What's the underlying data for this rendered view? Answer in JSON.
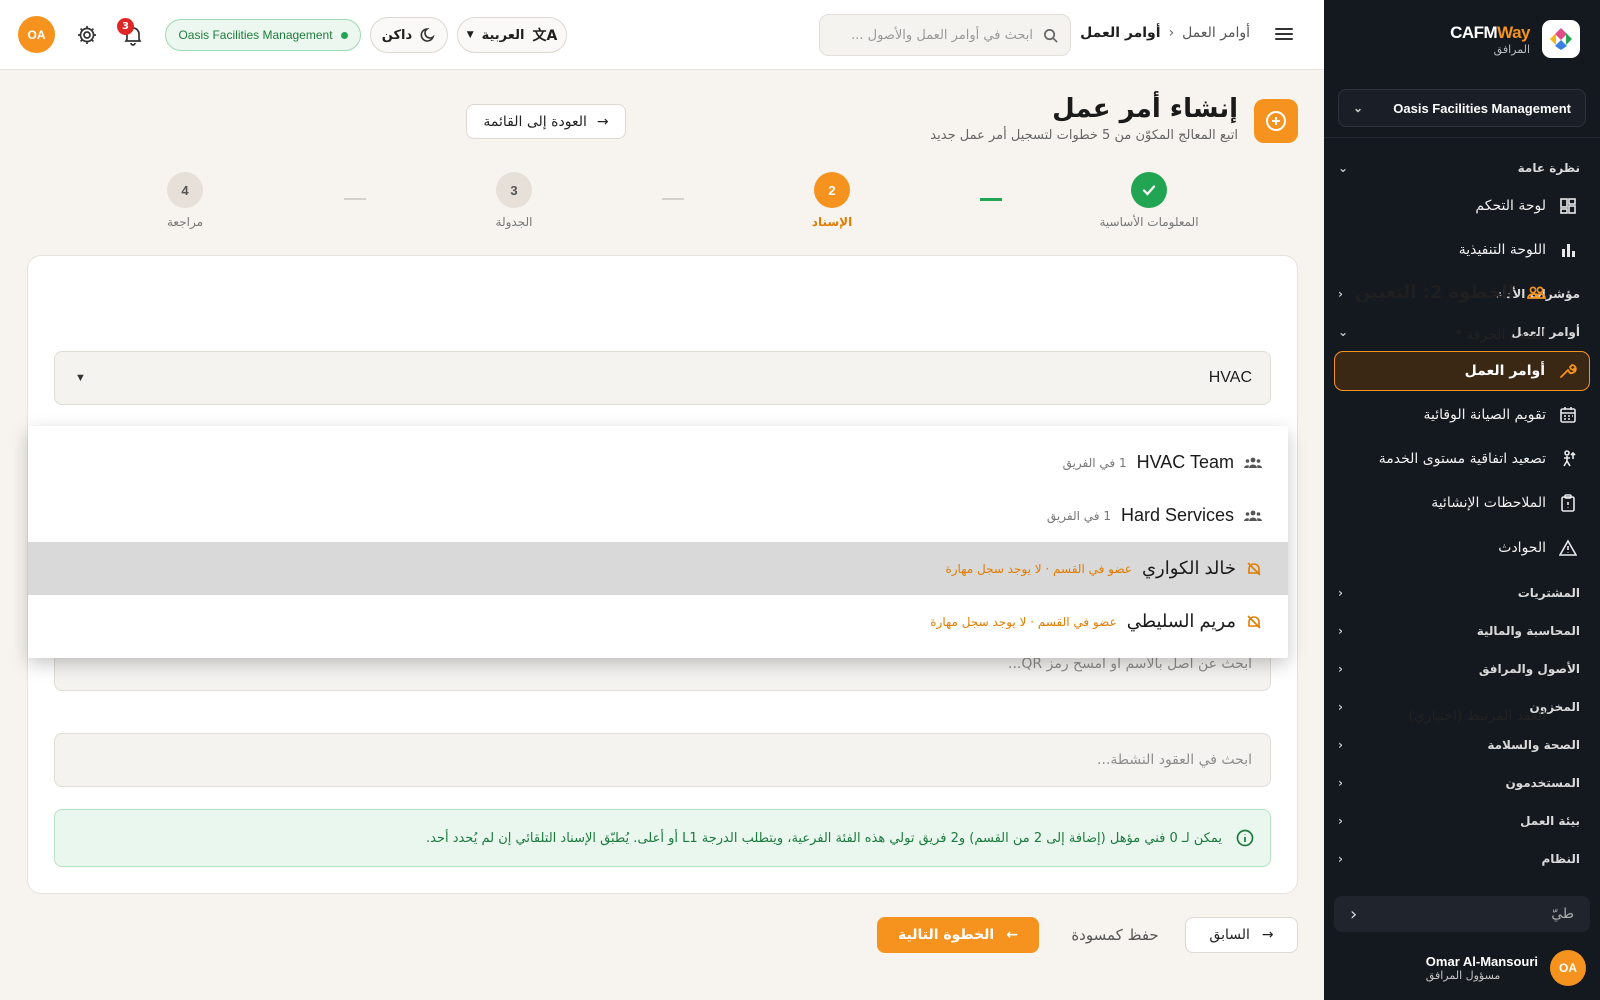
{
  "sidebar": {
    "brand_title_main": "CAFM",
    "brand_title_accent": "Way",
    "brand_subtitle": "المرافق",
    "org_selector": "Oasis Facilities Management",
    "sections": {
      "overview": "نظرة عامة",
      "kpi": "مؤشرات الأداء",
      "work_orders": "أوامر العمل",
      "procurement": "المشتريات",
      "accounting": "المحاسبة والمالية",
      "assets": "الأصول والمرافق",
      "inventory": "المخزون",
      "hse": "الصحة والسلامة",
      "users": "المستخدمون",
      "environment": "بيئة العمل",
      "system": "النظام"
    },
    "items": {
      "dashboard": "لوحة التحكم",
      "executive": "اللوحة التنفيذية",
      "work_orders": "أوامر العمل",
      "pm_calendar": "تقويم الصيانة الوقائية",
      "sla_escalation": "تصعيد اتفاقية مستوى الخدمة",
      "structural_notes": "الملاحظات الإنشائية",
      "incidents": "الحوادث"
    },
    "collapse_label": "طيّ",
    "user_initials": "OA",
    "user_name": "Omar Al-Mansouri",
    "user_role": "مسؤول المرافق"
  },
  "header": {
    "breadcrumb_parent": "أوامر العمل",
    "breadcrumb_current": "أوامر العمل",
    "search_placeholder": "ابحث في أوامر العمل والأصول ...",
    "language": "العربية",
    "theme": "داكن",
    "org": "Oasis Facilities Management",
    "notifications_count": "3",
    "avatar_initials": "OA"
  },
  "page": {
    "title": "إنشاء أمر عمل",
    "subtitle": "اتبع المعالج المكوّن من 5 خطوات لتسجيل أمر عمل جديد",
    "back_label": "العودة إلى القائمة"
  },
  "stepper": [
    {
      "label": "المعلومات الأساسية",
      "num": "1",
      "state": "done"
    },
    {
      "label": "الإسناد",
      "num": "2",
      "state": "current"
    },
    {
      "label": "الجدولة",
      "num": "3",
      "state": "todo"
    },
    {
      "label": "مراجعة",
      "num": "4",
      "state": "todo"
    }
  ],
  "form": {
    "section_title": "الخطوة 2: التعيين",
    "category_label": "الفئة / الحرفة *",
    "category_value": "HVAC",
    "asset_placeholder": "ابحث عن أصل بالاسم أو امسح رمز QR...",
    "contract_label": "العقد المرتبط (اختياري)",
    "contract_placeholder": "ابحث في العقود النشطة...",
    "info_text": "يمكن لـ 0 فني مؤهل (إضافة إلى 2 من القسم) و2 فريق تولي هذه الفئة الفرعية، ويتطلب الدرجة L1 أو أعلى. يُطبّق الإسناد التلقائي إن لم يُحدد أحد."
  },
  "dropdown": [
    {
      "name": "HVAC Team",
      "meta": "1 في الفريق",
      "kind": "team"
    },
    {
      "name": "Hard Services",
      "meta": "1 في الفريق",
      "kind": "team"
    },
    {
      "name": "خالد الكواري",
      "meta": "عضو في القسم · لا يوجد سجل مهارة",
      "kind": "member"
    },
    {
      "name": "مريم السليطي",
      "meta": "عضو في القسم · لا يوجد سجل مهارة",
      "kind": "member"
    }
  ],
  "footer": {
    "prev_label": "السابق",
    "draft_label": "حفظ كمسودة",
    "next_label": "الخطوة التالية"
  },
  "colors": {
    "accent": "#f5931e",
    "success": "#22a552",
    "sidebar_bg": "#14181f"
  }
}
